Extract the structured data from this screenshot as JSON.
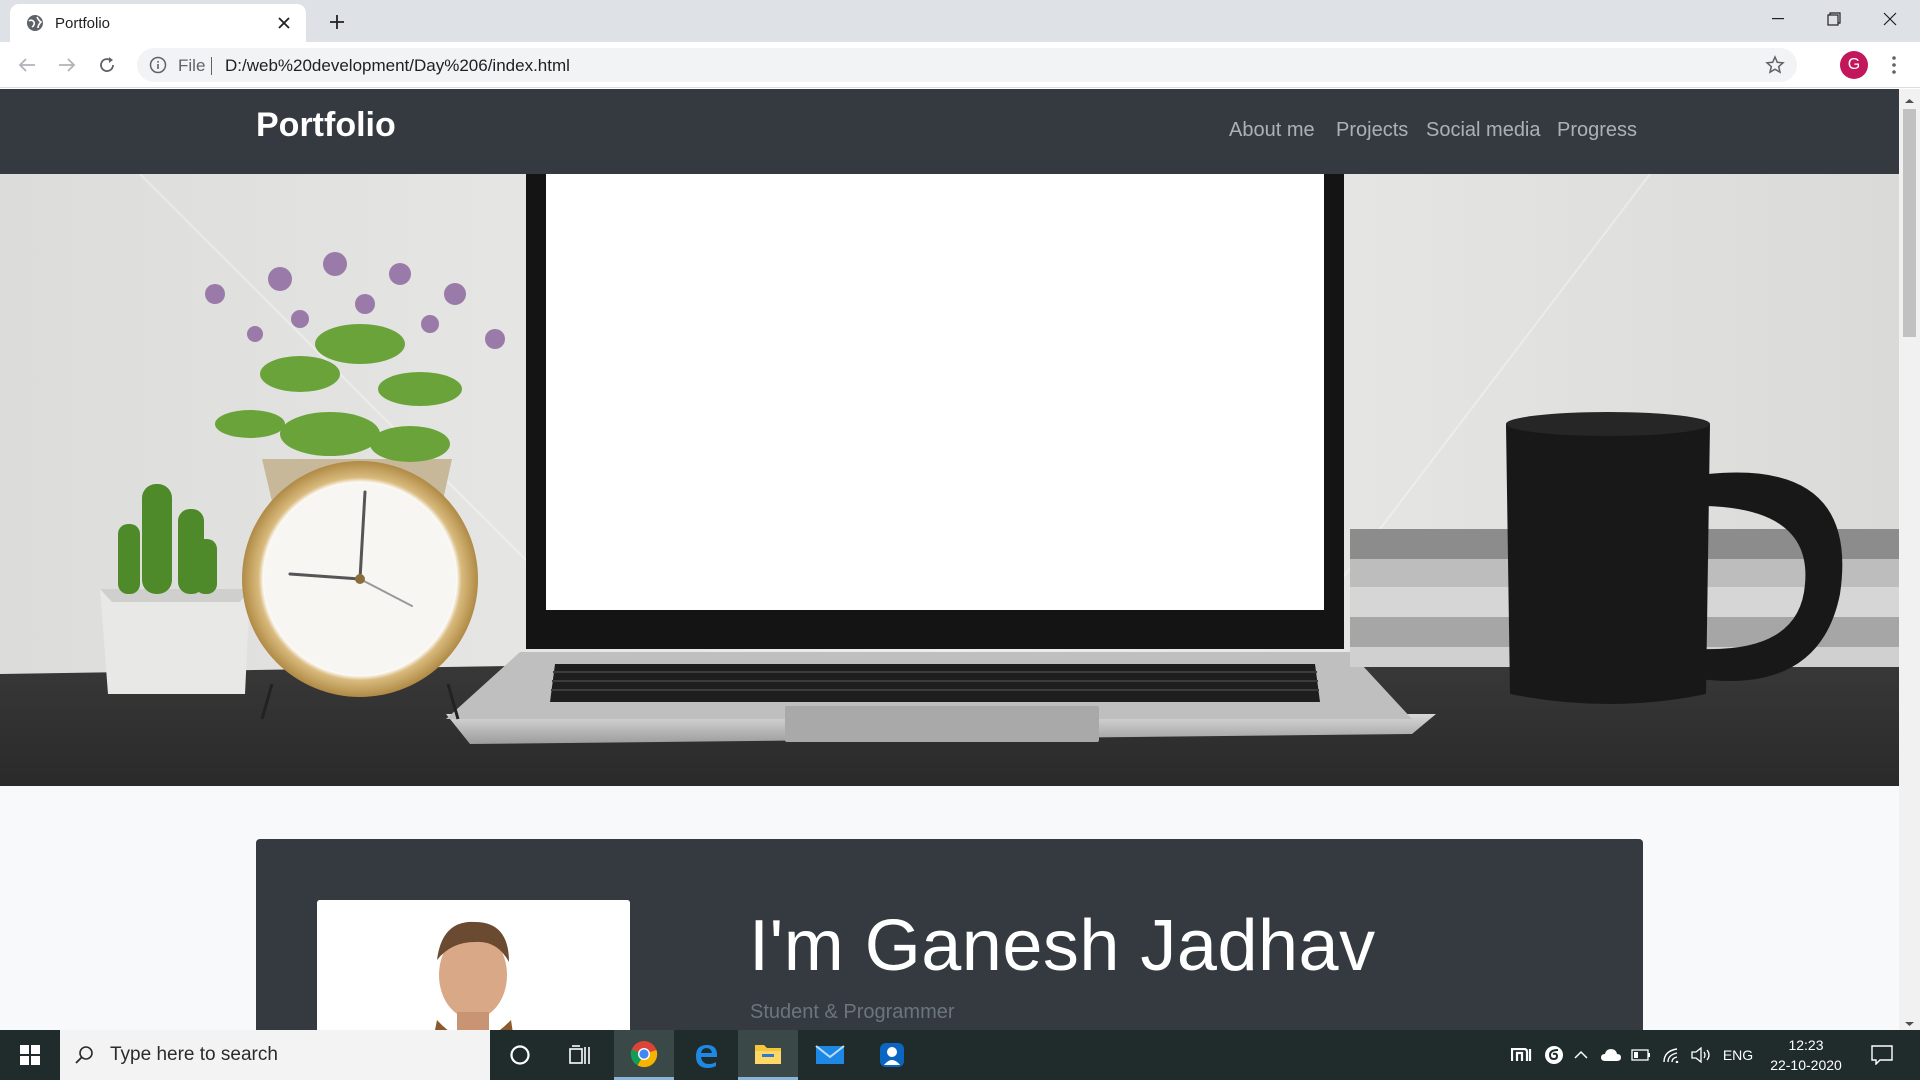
{
  "browser": {
    "tab_title": "Portfolio",
    "address_scheme": "File",
    "address_url": "D:/web%20development/Day%206/index.html",
    "profile_initial": "G"
  },
  "site": {
    "brand": "Portfolio",
    "nav": [
      "About me",
      "Projects",
      "Social media",
      "Progress"
    ],
    "about": {
      "name": "I'm Ganesh Jadhav",
      "subtitle": "Student & Programmer"
    }
  },
  "taskbar": {
    "search_placeholder": "Type here to search",
    "language": "ENG",
    "time": "12:23",
    "date": "22-10-2020",
    "pinned": [
      "cortana-icon",
      "task-view-icon",
      "chrome-icon",
      "edge-icon",
      "file-explorer-icon",
      "mail-icon",
      "user-app-icon"
    ]
  },
  "colors": {
    "navbar_bg": "#343a40",
    "page_bg": "#f8f9fa",
    "taskbar_bg": "#202c2c",
    "avatar_bg": "#c2185b"
  }
}
